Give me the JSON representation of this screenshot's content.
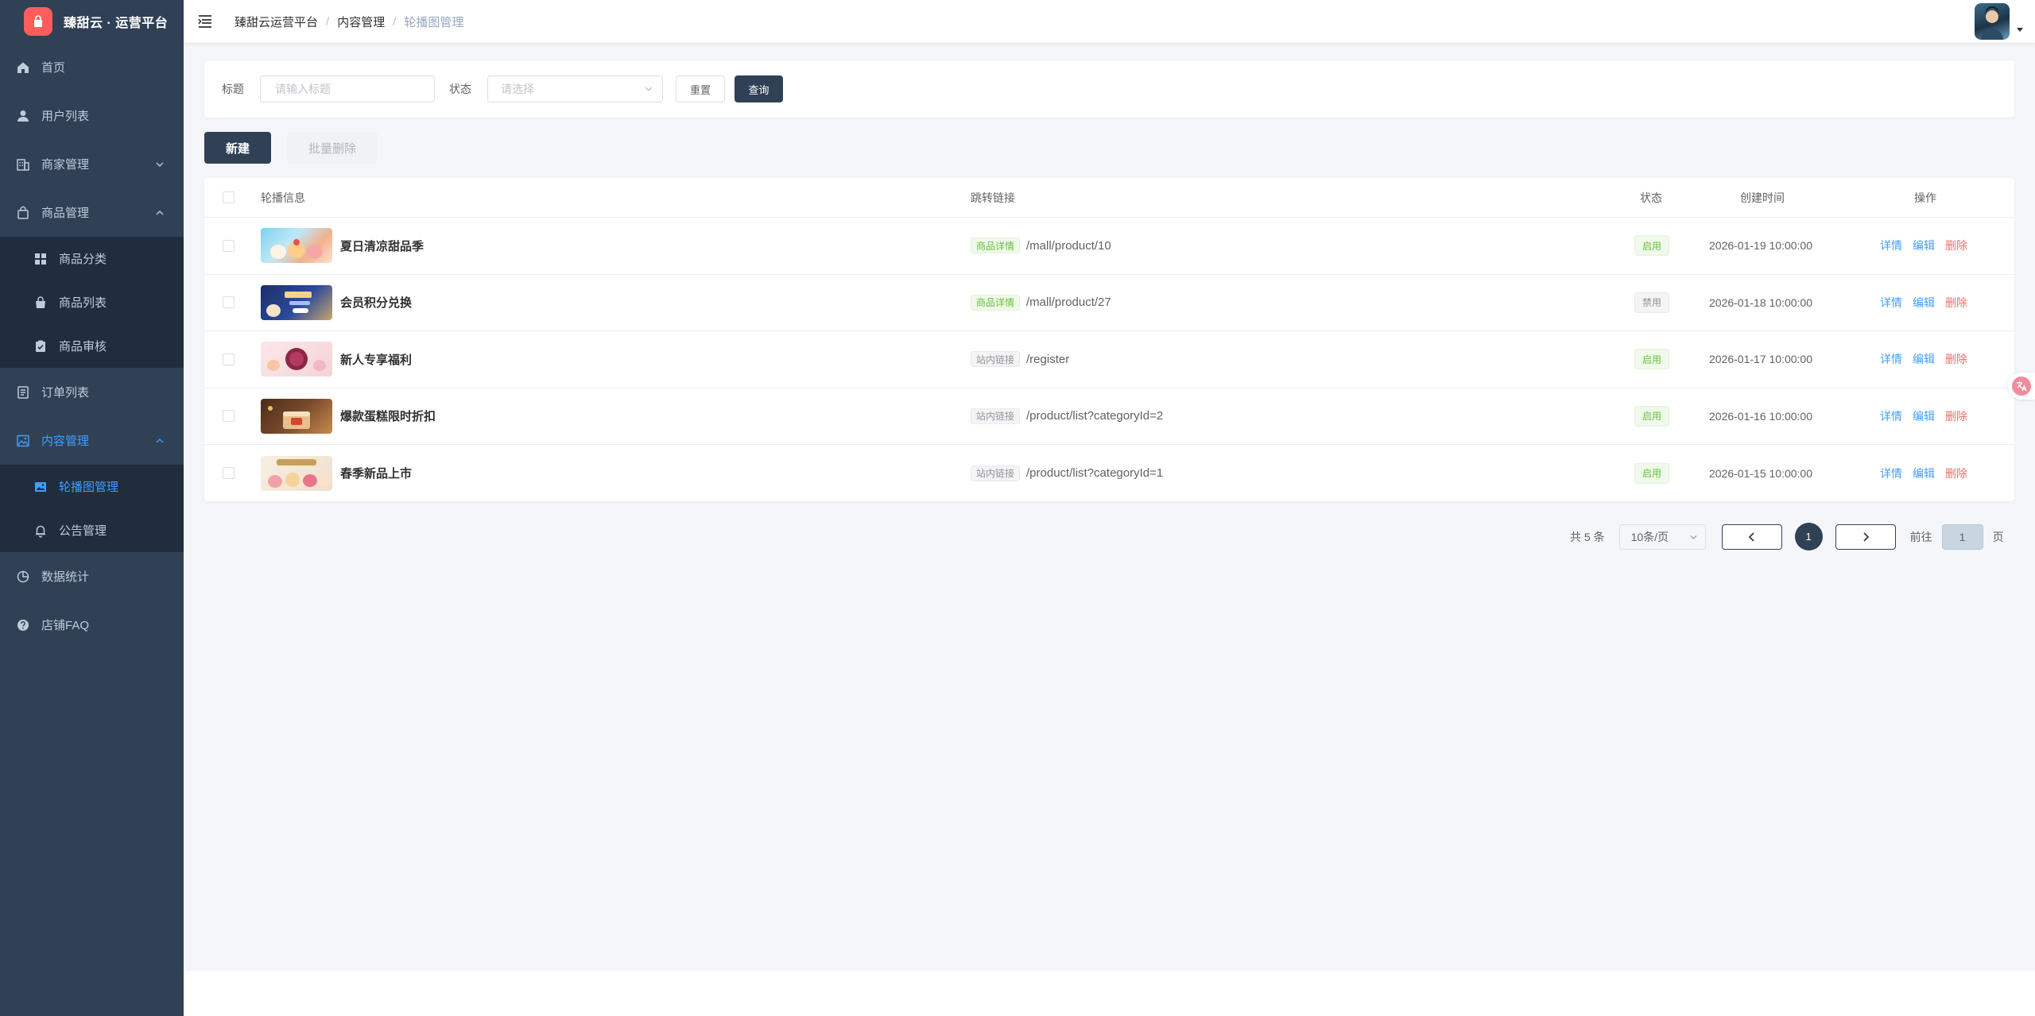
{
  "app": {
    "title": "臻甜云 · 运营平台"
  },
  "sidebar": {
    "items": [
      {
        "label": "首页",
        "icon": "home-icon"
      },
      {
        "label": "用户列表",
        "icon": "user-icon"
      },
      {
        "label": "商家管理",
        "icon": "building-icon",
        "expandable": true
      },
      {
        "label": "商品管理",
        "icon": "bag-icon",
        "expanded": true,
        "children": [
          {
            "label": "商品分类",
            "icon": "grid-icon"
          },
          {
            "label": "商品列表",
            "icon": "shopping-bag-icon"
          },
          {
            "label": "商品审核",
            "icon": "clipboard-check-icon"
          }
        ]
      },
      {
        "label": "订单列表",
        "icon": "document-icon"
      },
      {
        "label": "内容管理",
        "icon": "picture-icon",
        "expanded": true,
        "active": true,
        "children": [
          {
            "label": "轮播图管理",
            "icon": "image-icon",
            "active": true
          },
          {
            "label": "公告管理",
            "icon": "bell-icon"
          }
        ]
      },
      {
        "label": "数据统计",
        "icon": "pie-chart-icon"
      },
      {
        "label": "店铺FAQ",
        "icon": "question-icon"
      }
    ]
  },
  "header": {
    "breadcrumb": [
      "臻甜云运营平台",
      "内容管理",
      "轮播图管理"
    ]
  },
  "filter": {
    "title_label": "标题",
    "title_placeholder": "请输入标题",
    "status_label": "状态",
    "status_placeholder": "请选择",
    "reset_label": "重置",
    "query_label": "查询"
  },
  "actions": {
    "new_label": "新建",
    "batch_delete_label": "批量删除"
  },
  "table": {
    "columns": {
      "info": "轮播信息",
      "link": "跳转链接",
      "status": "状态",
      "created": "创建时间",
      "ops": "操作"
    },
    "rows": [
      {
        "title": "夏日清凉甜品季",
        "link_type": "商品详情",
        "link_kind": "product",
        "link": "/mall/product/10",
        "status": "启用",
        "status_kind": "on",
        "created": "2026-01-19 10:00:00"
      },
      {
        "title": "会员积分兑换",
        "link_type": "商品详情",
        "link_kind": "product",
        "link": "/mall/product/27",
        "status": "禁用",
        "status_kind": "off",
        "created": "2026-01-18 10:00:00"
      },
      {
        "title": "新人专享福利",
        "link_type": "站内链接",
        "link_kind": "internal",
        "link": "/register",
        "status": "启用",
        "status_kind": "on",
        "created": "2026-01-17 10:00:00"
      },
      {
        "title": "爆款蛋糕限时折扣",
        "link_type": "站内链接",
        "link_kind": "internal",
        "link": "/product/list?categoryId=2",
        "status": "启用",
        "status_kind": "on",
        "created": "2026-01-16 10:00:00"
      },
      {
        "title": "春季新品上市",
        "link_type": "站内链接",
        "link_kind": "internal",
        "link": "/product/list?categoryId=1",
        "status": "启用",
        "status_kind": "on",
        "created": "2026-01-15 10:00:00"
      }
    ],
    "op_labels": {
      "detail": "详情",
      "edit": "编辑",
      "delete": "删除"
    }
  },
  "pagination": {
    "total": "共 5 条",
    "page_size": "10条/页",
    "current_page": "1",
    "goto_label": "前往",
    "goto_value": "1",
    "page_suffix": "页"
  },
  "colors": {
    "sidebar_bg": "#304156",
    "accent": "#409eff",
    "primary_dark": "#304156",
    "danger": "#f56c6c",
    "success": "#67c23a"
  }
}
